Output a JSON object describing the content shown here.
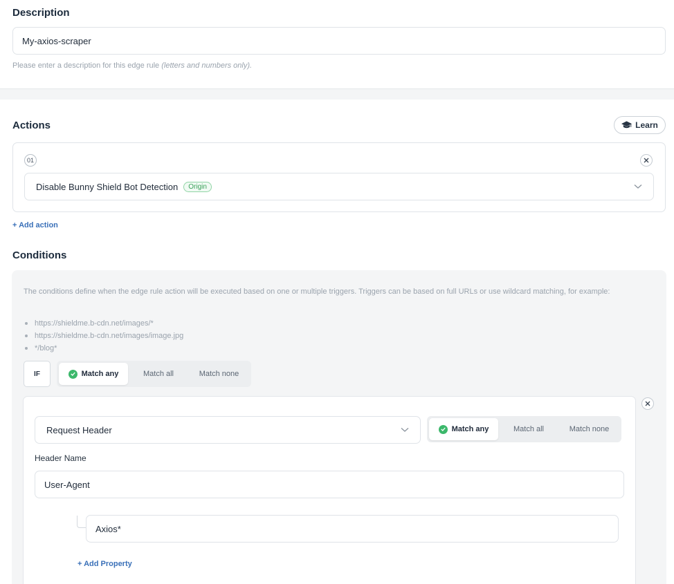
{
  "description": {
    "title": "Description",
    "value": "My-axios-scraper",
    "hint": "Please enter a description for this edge rule",
    "hint_italic": "(letters and numbers only)."
  },
  "actions": {
    "title": "Actions",
    "learn_label": "Learn",
    "items": [
      {
        "number": "01",
        "label": "Disable Bunny Shield Bot Detection",
        "badge": "Origin"
      }
    ],
    "add_label": "+ Add action"
  },
  "conditions": {
    "title": "Conditions",
    "description": "The conditions define when the edge rule action will be executed based on one or multiple triggers. Triggers can be based on full URLs or use wildcard matching, for example:",
    "examples": [
      "https://shieldme.b-cdn.net/images/*",
      "https://shieldme.b-cdn.net/images/image.jpg",
      "*/blog*"
    ],
    "if_label": "IF",
    "match_options": [
      "Match any",
      "Match all",
      "Match none"
    ],
    "selected_match": "Match any",
    "trigger": {
      "type_value": "Request Header",
      "match_options": [
        "Match any",
        "Match all",
        "Match none"
      ],
      "selected_match": "Match any",
      "header_name_label": "Header Name",
      "header_name_value": "User-Agent",
      "property_values": [
        "Axios*"
      ],
      "add_property_label": "+ Add Property"
    }
  },
  "colors": {
    "accent_link": "#3a70b8",
    "success_green": "#3cb86b",
    "panel_bg": "#f4f5f6"
  }
}
